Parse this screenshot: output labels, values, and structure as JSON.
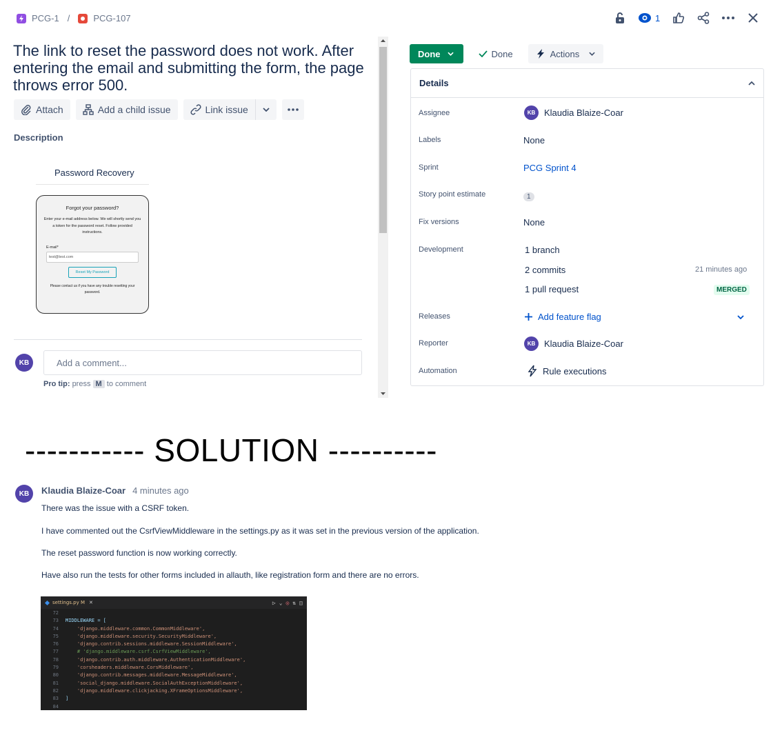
{
  "breadcrumb": {
    "parent": "PCG-1",
    "separator": "/",
    "current": "PCG-107"
  },
  "topbar": {
    "watch_count": "1"
  },
  "issue": {
    "title": "The link to reset the password does not work. After entering the email and submitting the form, the page throws error 500.",
    "buttons": {
      "attach": "Attach",
      "add_child": "Add a child issue",
      "link_issue": "Link issue"
    },
    "description_label": "Description",
    "embedded_image": {
      "title": "Password Recovery",
      "heading": "Forgot your password?",
      "text": "Enter your e-mail address below. We will shortly send you a token for the password reset. Follow provided instructions.",
      "email_label": "E-mail*",
      "email_value": "test@test.com",
      "button": "Reset My Password",
      "footer": "Please contact us if you have any trouble resetting your password."
    },
    "comment": {
      "avatar": "KB",
      "placeholder": "Add a comment...",
      "protip_prefix": "Pro tip:",
      "protip_press": "press",
      "protip_key": "M",
      "protip_suffix": "to comment"
    }
  },
  "status": {
    "button": "Done",
    "transition": "Done",
    "actions": "Actions"
  },
  "details": {
    "header": "Details",
    "assignee": {
      "label": "Assignee",
      "avatar": "KB",
      "value": "Klaudia Blaize-Coar"
    },
    "labels": {
      "label": "Labels",
      "value": "None"
    },
    "sprint": {
      "label": "Sprint",
      "value": "PCG Sprint 4"
    },
    "story_points": {
      "label": "Story point estimate",
      "value": "1"
    },
    "fix_versions": {
      "label": "Fix versions",
      "value": "None"
    },
    "development": {
      "label": "Development",
      "branch": "1 branch",
      "commits": "2 commits",
      "commits_time": "21 minutes ago",
      "pull_request": "1 pull request",
      "pr_status": "MERGED"
    },
    "releases": {
      "label": "Releases",
      "value": "Add feature flag"
    },
    "reporter": {
      "label": "Reporter",
      "avatar": "KB",
      "value": "Klaudia Blaize-Coar"
    },
    "automation": {
      "label": "Automation",
      "value": "Rule executions"
    }
  },
  "solution_heading": "----------- SOLUTION ----------",
  "solution_comment": {
    "avatar": "KB",
    "author": "Klaudia Blaize-Coar",
    "time": "4 minutes ago",
    "paragraphs": [
      "There was the issue with a CSRF token.",
      "I have commented out the CsrfViewMiddleware in the settings.py as it was set in the previous version of the application.",
      "The reset password function is now working correctly.",
      "Have also run the tests for other forms included in allauth, like registration form and there are no errors."
    ]
  },
  "code": {
    "tab": "settings.py M",
    "lines": [
      {
        "n": "72",
        "t": ""
      },
      {
        "n": "73",
        "t": "MIDDLEWARE = ["
      },
      {
        "n": "74",
        "t": "    'django.middleware.common.CommonMiddleware',"
      },
      {
        "n": "75",
        "t": "    'django.middleware.security.SecurityMiddleware',"
      },
      {
        "n": "76",
        "t": "    'django.contrib.sessions.middleware.SessionMiddleware',"
      },
      {
        "n": "77",
        "t": "    # 'django.middleware.csrf.CsrfViewMiddleware',"
      },
      {
        "n": "78",
        "t": "    'django.contrib.auth.middleware.AuthenticationMiddleware',"
      },
      {
        "n": "79",
        "t": "    'corsheaders.middleware.CorsMiddleware',"
      },
      {
        "n": "80",
        "t": "    'django.contrib.messages.middleware.MessageMiddleware',"
      },
      {
        "n": "81",
        "t": "    'social_django.middleware.SocialAuthExceptionMiddleware',"
      },
      {
        "n": "82",
        "t": "    'django.middleware.clickjacking.XFrameOptionsMiddleware',"
      },
      {
        "n": "83",
        "t": "]"
      },
      {
        "n": "84",
        "t": ""
      }
    ]
  }
}
